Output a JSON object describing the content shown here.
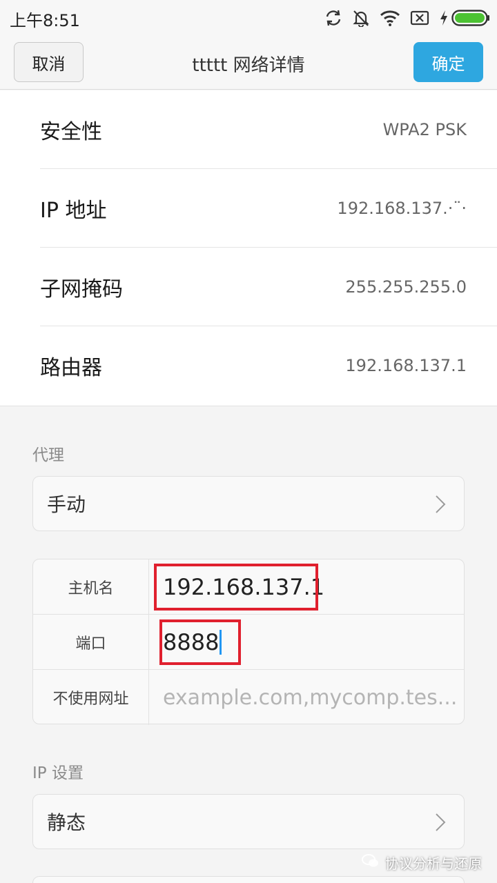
{
  "status_bar": {
    "time": "上午8:51",
    "icons": [
      "sync-icon",
      "bell-off-icon",
      "wifi-icon",
      "sim-x-icon",
      "charging-icon",
      "battery-icon"
    ],
    "battery_color": "#4cc233"
  },
  "title_bar": {
    "cancel_label": "取消",
    "title": "ttttt  网络详情",
    "confirm_label": "确定",
    "accent_color": "#2ea7e0"
  },
  "details": [
    {
      "label": "安全性",
      "value": "WPA2 PSK"
    },
    {
      "label": "IP 地址",
      "value": "192.168.137.·¨·"
    },
    {
      "label": "子网掩码",
      "value": "255.255.255.0"
    },
    {
      "label": "路由器",
      "value": "192.168.137.1"
    }
  ],
  "proxy": {
    "section_label": "代理",
    "mode": "手动",
    "host_label": "主机名",
    "host_value": "192.168.137.1",
    "port_label": "端口",
    "port_value": "8888",
    "bypass_label": "不使用网址",
    "bypass_placeholder": "example.com,mycomp.tes..."
  },
  "ip_settings": {
    "section_label": "IP 设置",
    "mode": "静态"
  },
  "watermark": "协议分析与还原"
}
